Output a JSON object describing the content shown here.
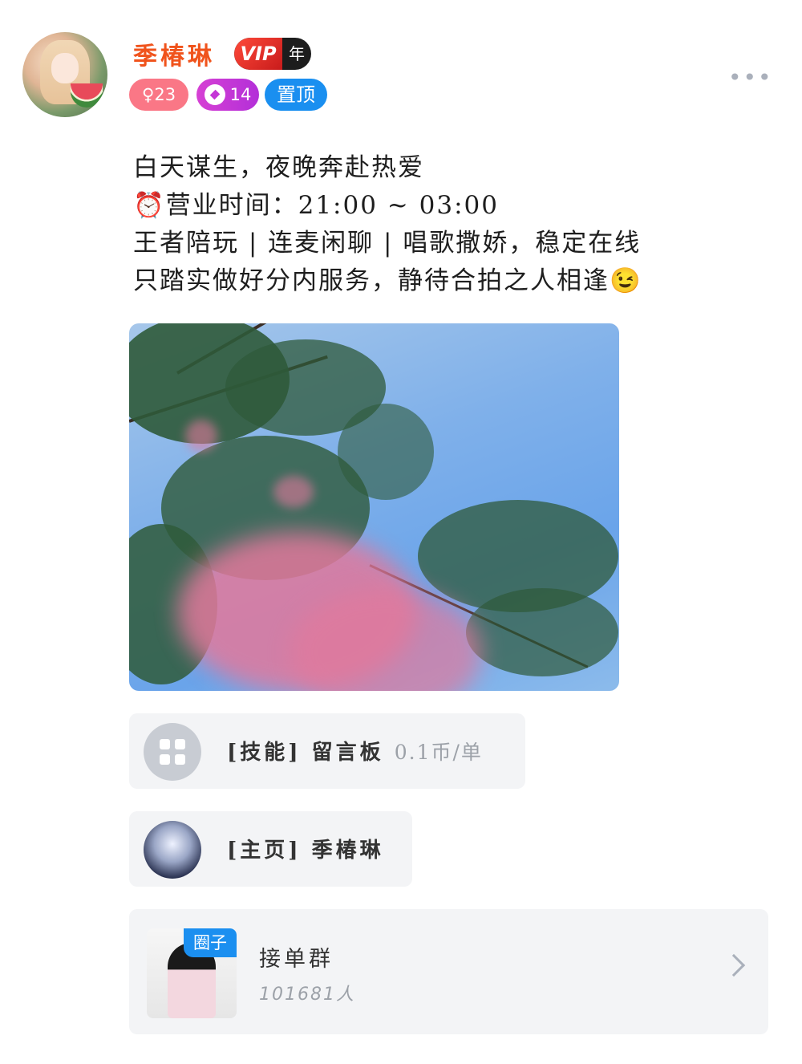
{
  "user": {
    "name": "季椿琳",
    "vip_label": "VIP",
    "vip_period": "年",
    "gender_symbol": "♀",
    "age": "23",
    "level": "14",
    "pinned_label": "置顶",
    "more_icon": "ellipsis-icon"
  },
  "post": {
    "lines": [
      "白天谋生，夜晚奔赴热爱",
      "⏰营业时间：21:00 ~ 03:00",
      "王者陪玩 | 连麦闲聊 | 唱歌撒娇，稳定在线",
      "只踏实做好分内服务，静待合拍之人相逢😉"
    ]
  },
  "skill_card": {
    "tag": "[技能]",
    "title": "留言板",
    "price": "0.1币/单",
    "icon": "grid-icon"
  },
  "home_card": {
    "tag": "[主页]",
    "title": "季椿琳"
  },
  "group_card": {
    "badge": "圈子",
    "name": "接单群",
    "count": "101681人",
    "icon": "chevron-right-icon"
  },
  "colors": {
    "name": "#f0531c",
    "pinned": "#1a8ff0",
    "gender_badge": "#fa7786",
    "level_badge": "#c436d6"
  }
}
